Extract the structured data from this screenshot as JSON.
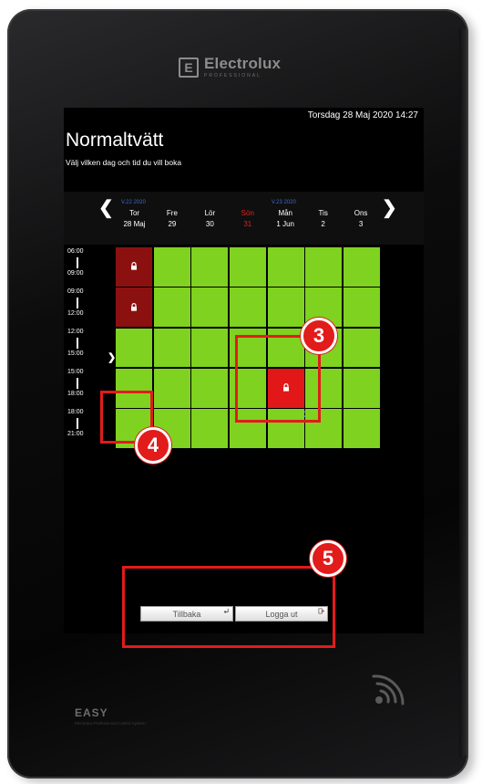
{
  "brand": {
    "name": "Electrolux",
    "sub": "PROFESSIONAL"
  },
  "datetime": "Torsdag 28 Maj 2020  14:27",
  "title": "Normaltvätt",
  "subtitle": "Välj vilken dag och tid du vill boka",
  "weeks": [
    {
      "label": "V.22 2020"
    },
    {
      "label": "V.23 2020"
    }
  ],
  "days": [
    {
      "name": "Tor",
      "num": "28 Maj",
      "sunday": false
    },
    {
      "name": "Fre",
      "num": "29",
      "sunday": false
    },
    {
      "name": "Lör",
      "num": "30",
      "sunday": false
    },
    {
      "name": "Sön",
      "num": "31",
      "sunday": true
    },
    {
      "name": "Mån",
      "num": "1 Jun",
      "sunday": false
    },
    {
      "name": "Tis",
      "num": "2",
      "sunday": false
    },
    {
      "name": "Ons",
      "num": "3",
      "sunday": false
    }
  ],
  "time_slots": [
    {
      "start": "06:00",
      "end": "09:00"
    },
    {
      "start": "09:00",
      "end": "12:00"
    },
    {
      "start": "12:00",
      "end": "15:00"
    },
    {
      "start": "15:00",
      "end": "18:00"
    },
    {
      "start": "18:00",
      "end": "21:00"
    }
  ],
  "bookings": [
    {
      "slot": 0,
      "day": 0,
      "status": "booked-other",
      "icon": "lock-icon"
    },
    {
      "slot": 1,
      "day": 0,
      "status": "booked-other",
      "icon": "lock-icon"
    },
    {
      "slot": 3,
      "day": 4,
      "status": "booked-mine",
      "icon": "lock-icon",
      "user_marker": "user-icon"
    }
  ],
  "colors": {
    "available": "#7fd21f",
    "booked_other": "#8b1111",
    "booked_mine": "#e21818",
    "callout": "#e21b1b"
  },
  "callouts": {
    "c3": "3",
    "c4": "4",
    "c5": "5"
  },
  "buttons": {
    "back_label": "Tillbaka",
    "logout_label": "Logga ut"
  },
  "footer": {
    "easy": "EASY",
    "easy_sub": "Electrolux Professional Control System"
  }
}
